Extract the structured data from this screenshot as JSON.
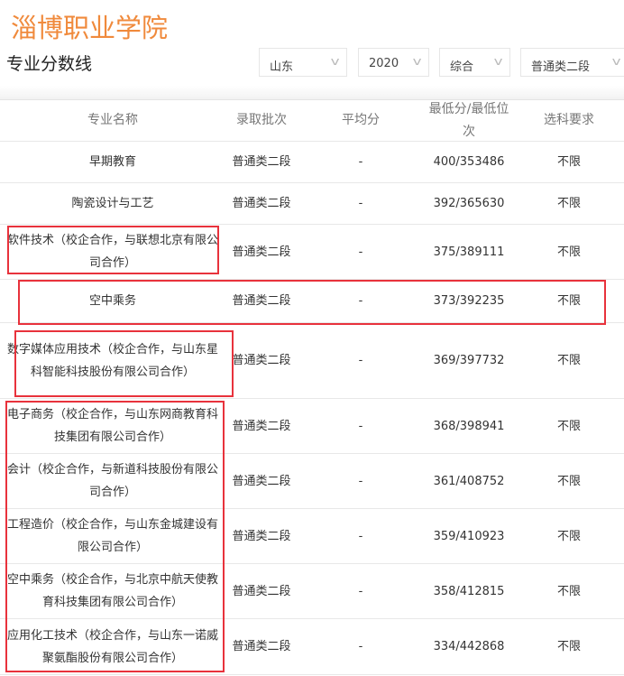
{
  "header": {
    "school": "淄博职业学院",
    "section": "专业分数线"
  },
  "filters": [
    {
      "value": "山东"
    },
    {
      "value": "2020"
    },
    {
      "value": "综合"
    },
    {
      "value": "普通类二段"
    }
  ],
  "table": {
    "columns": [
      "专业名称",
      "录取批次",
      "平均分",
      "最低分/最低位次",
      "选科要求"
    ],
    "rows": [
      {
        "name": "早期教育",
        "batch": "普通类二段",
        "avg": "-",
        "min": "400/353486",
        "req": "不限"
      },
      {
        "name": "陶瓷设计与工艺",
        "batch": "普通类二段",
        "avg": "-",
        "min": "392/365630",
        "req": "不限"
      },
      {
        "name": "软件技术（校企合作，与联想北京有限公司合作）",
        "batch": "普通类二段",
        "avg": "-",
        "min": "375/389111",
        "req": "不限"
      },
      {
        "name": "空中乘务",
        "batch": "普通类二段",
        "avg": "-",
        "min": "373/392235",
        "req": "不限"
      },
      {
        "name": "数字媒体应用技术（校企合作，与山东星科智能科技股份有限公司合作）",
        "batch": "普通类二段",
        "avg": "-",
        "min": "369/397732",
        "req": "不限"
      },
      {
        "name": "电子商务（校企合作，与山东网商教育科技集团有限公司合作）",
        "batch": "普通类二段",
        "avg": "-",
        "min": "368/398941",
        "req": "不限"
      },
      {
        "name": "会计（校企合作，与新道科技股份有限公司合作）",
        "batch": "普通类二段",
        "avg": "-",
        "min": "361/408752",
        "req": "不限"
      },
      {
        "name": "工程造价（校企合作，与山东金城建设有限公司合作）",
        "batch": "普通类二段",
        "avg": "-",
        "min": "359/410923",
        "req": "不限"
      },
      {
        "name": "空中乘务（校企合作，与北京中航天使教育科技集团有限公司合作）",
        "batch": "普通类二段",
        "avg": "-",
        "min": "358/412815",
        "req": "不限"
      },
      {
        "name": "应用化工技术（校企合作，与山东一诺威聚氨酯股份有限公司合作）",
        "batch": "普通类二段",
        "avg": "-",
        "min": "334/442868",
        "req": "不限"
      }
    ]
  }
}
